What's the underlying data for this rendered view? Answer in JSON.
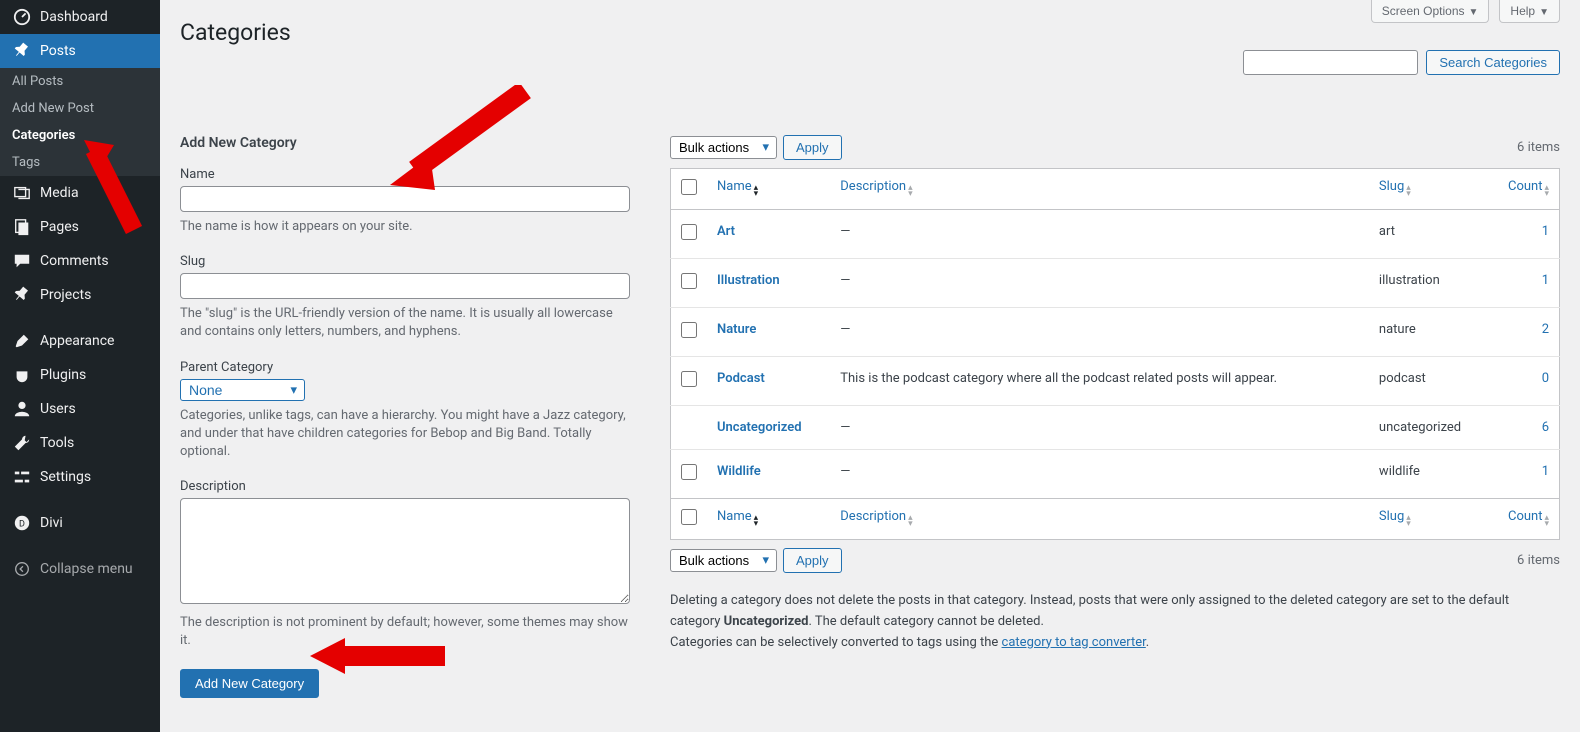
{
  "sidebar": {
    "items": [
      {
        "label": "Dashboard",
        "icon": "dashboard"
      },
      {
        "label": "Posts",
        "icon": "pin",
        "current": true
      },
      {
        "label": "Media",
        "icon": "media"
      },
      {
        "label": "Pages",
        "icon": "pages"
      },
      {
        "label": "Comments",
        "icon": "comments"
      },
      {
        "label": "Projects",
        "icon": "pin"
      },
      {
        "label": "Appearance",
        "icon": "appearance"
      },
      {
        "label": "Plugins",
        "icon": "plugins"
      },
      {
        "label": "Users",
        "icon": "users"
      },
      {
        "label": "Tools",
        "icon": "tools"
      },
      {
        "label": "Settings",
        "icon": "settings"
      },
      {
        "label": "Divi",
        "icon": "divi"
      },
      {
        "label": "Collapse menu",
        "icon": "collapse"
      }
    ],
    "submenu": [
      {
        "label": "All Posts"
      },
      {
        "label": "Add New Post"
      },
      {
        "label": "Categories",
        "current": true
      },
      {
        "label": "Tags"
      }
    ]
  },
  "topbar": {
    "screen_options": "Screen Options",
    "help": "Help"
  },
  "page": {
    "title": "Categories"
  },
  "form": {
    "title": "Add New Category",
    "name_label": "Name",
    "name_desc": "The name is how it appears on your site.",
    "slug_label": "Slug",
    "slug_desc": "The \"slug\" is the URL-friendly version of the name. It is usually all lowercase and contains only letters, numbers, and hyphens.",
    "parent_label": "Parent Category",
    "parent_value": "None",
    "parent_desc": "Categories, unlike tags, can have a hierarchy. You might have a Jazz category, and under that have children categories for Bebop and Big Band. Totally optional.",
    "desc_label": "Description",
    "desc_desc": "The description is not prominent by default; however, some themes may show it.",
    "submit": "Add New Category"
  },
  "search": {
    "button": "Search Categories"
  },
  "bulk": {
    "label": "Bulk actions",
    "apply": "Apply"
  },
  "table": {
    "count": "6 items",
    "headers": {
      "name": "Name",
      "description": "Description",
      "slug": "Slug",
      "count": "Count"
    },
    "rows": [
      {
        "name": "Art",
        "description": "—",
        "slug": "art",
        "count": "1",
        "check": true
      },
      {
        "name": "Illustration",
        "description": "—",
        "slug": "illustration",
        "count": "1",
        "check": true
      },
      {
        "name": "Nature",
        "description": "—",
        "slug": "nature",
        "count": "2",
        "check": true
      },
      {
        "name": "Podcast",
        "description": "This is the podcast category where all the podcast related posts will appear.",
        "slug": "podcast",
        "count": "0",
        "check": true
      },
      {
        "name": "Uncategorized",
        "description": "—",
        "slug": "uncategorized",
        "count": "6",
        "check": false
      },
      {
        "name": "Wildlife",
        "description": "—",
        "slug": "wildlife",
        "count": "1",
        "check": true
      }
    ]
  },
  "footer": {
    "note1a": "Deleting a category does not delete the posts in that category. Instead, posts that were only assigned to the deleted category are set to the default category ",
    "note1b": "Uncategorized",
    "note1c": ". The default category cannot be deleted.",
    "note2a": "Categories can be selectively converted to tags using the ",
    "note2_link": "category to tag converter",
    "note2b": "."
  }
}
